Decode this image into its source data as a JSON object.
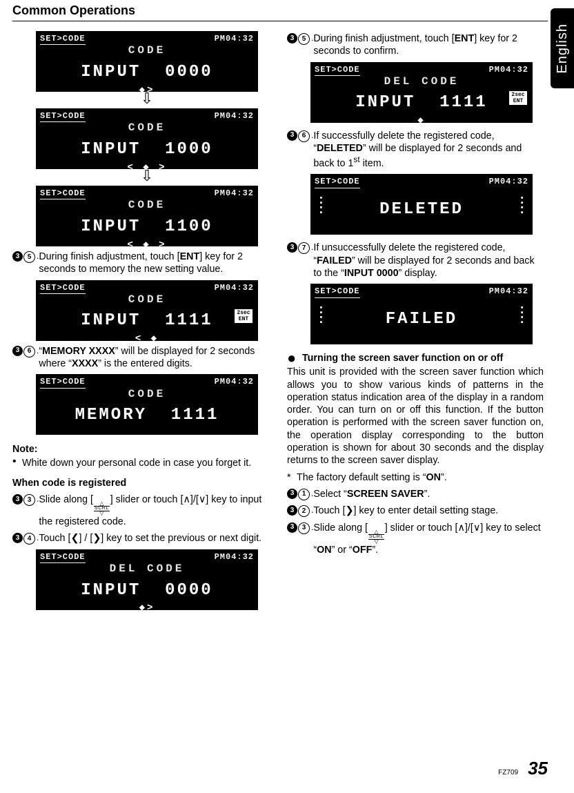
{
  "header": {
    "title": "Common Operations"
  },
  "side_tab": {
    "label": "English"
  },
  "footer": {
    "model": "FZ709",
    "page": "35"
  },
  "lcd_common": {
    "top_left": "SET>CODE",
    "top_right": "PM04:32",
    "title_code": "CODE",
    "title_del": "DEL  CODE",
    "nav_right": "◆>",
    "nav_both": "< ◆ >",
    "nav_left": "< ◆",
    "badge": "2sec\nENT"
  },
  "left": {
    "lcd1_main": "INPUT  0000",
    "lcd2_main": "INPUT  1000",
    "lcd3_main": "INPUT  1100",
    "step5_pre": "During finish adjustment, touch [",
    "step5_ent": "ENT",
    "step5_post": "] key for 2 seconds to memory the new setting value.",
    "lcd4_main": "INPUT  1111",
    "step6_a": "“",
    "step6_mem": "MEMORY XXXX",
    "step6_b": "” will be displayed for 2 seconds where “",
    "step6_xxxx": "XXXX",
    "step6_c": "” is the entered digits.",
    "lcd5_main": "MEMORY  1111",
    "note_head": "Note:",
    "note_text": "White down your personal code in case you forget it.",
    "subhead": "When code is registered",
    "step3_a": "Slide along [",
    "step3_b": "] slider or touch [",
    "step3_c": "]/[",
    "step3_d": "] key to input the registered code.",
    "step4_a": "Touch [",
    "step4_b": "] / [",
    "step4_c": "] key to set the previous or next digit.",
    "lcd6_main": "INPUT  0000",
    "scrl": "SCRL",
    "sym_up": "∧",
    "sym_down": "∨",
    "sym_lt": "❮",
    "sym_gt": "❯"
  },
  "right": {
    "step5_a": "During finish adjustment, touch [",
    "step5_ent": "ENT",
    "step5_b": "] key for 2 seconds to confirm.",
    "lcd1_main": "INPUT  1111",
    "step6_a": "If successfully delete the registered code, “",
    "step6_del": "DELETED",
    "step6_b": "” will be displayed for 2 seconds and back to 1",
    "step6_st": "st",
    "step6_c": " item.",
    "lcd2_main": "DELETED",
    "step7_a": "If unsuccessfully delete the registered code, “",
    "step7_fail": "FAILED",
    "step7_b": "” will be displayed for 2 seconds and back to the “",
    "step7_inp": "INPUT 0000",
    "step7_c": "” display.",
    "lcd3_main": "FAILED",
    "topic": "Turning the screen saver function on or off",
    "para1": "This unit is provided with the screen saver function which allows you to show various kinds of patterns in the operation status indication area of the display in a random order. You can turn on or off this function. If the button operation is performed with the screen saver function on, the operation display corresponding to the button operation is shown for about 30 seconds and the display returns to the screen saver display.",
    "asterisk_a": "The factory default setting is “",
    "asterisk_on": "ON",
    "asterisk_b": "”.",
    "s1_a": "Select “",
    "s1_b": "SCREEN SAVER",
    "s1_c": "”.",
    "s2_a": "Touch [",
    "s2_b": "] key to enter detail setting stage.",
    "s3_a": "Slide along [",
    "s3_b": "] slider or touch [",
    "s3_c": "]/[",
    "s3_d": "] key to select “",
    "s3_on": "ON",
    "s3_e": "” or “",
    "s3_off": "OFF",
    "s3_f": "”.",
    "sym_gt": "❯",
    "sym_up": "∧",
    "sym_down": "∨",
    "scrl": "SCRL"
  }
}
